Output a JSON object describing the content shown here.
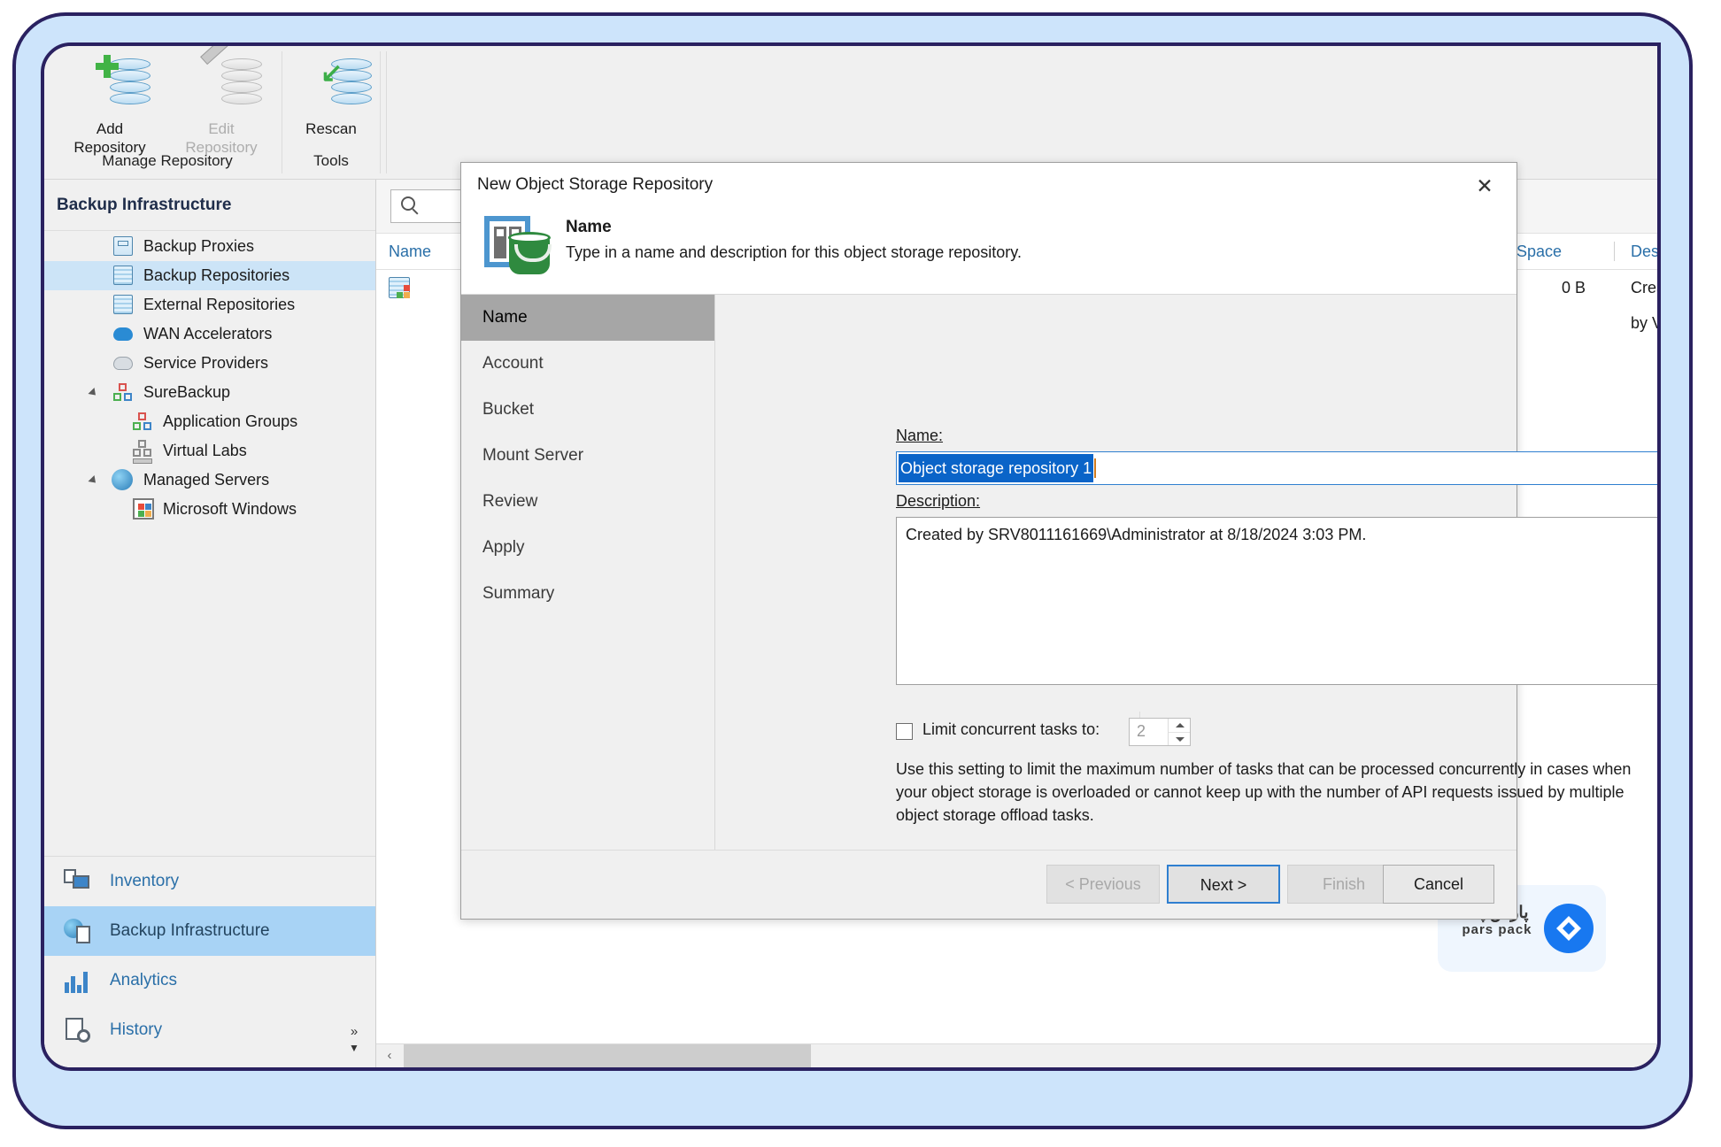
{
  "ribbon": {
    "groups": [
      {
        "label": "Manage Repository"
      },
      {
        "label": "Tools"
      }
    ],
    "buttons": [
      {
        "label_line1": "Add",
        "label_line2": "Repository",
        "icon": "database-add-icon",
        "enabled": true
      },
      {
        "label_line1": "Edit",
        "label_line2": "Repository",
        "icon": "database-edit-icon",
        "enabled": false
      },
      {
        "label_line1": "Rescan",
        "label_line2": "",
        "icon": "database-rescan-icon",
        "enabled": true
      }
    ]
  },
  "sidebar": {
    "title": "Backup Infrastructure",
    "items": [
      {
        "label": "Backup Proxies",
        "icon": "server-icon",
        "indent": 0,
        "selected": false,
        "expander": false
      },
      {
        "label": "Backup Repositories",
        "icon": "repository-icon",
        "indent": 0,
        "selected": true,
        "expander": false
      },
      {
        "label": "External Repositories",
        "icon": "cloud-repo-icon",
        "indent": 0,
        "selected": false,
        "expander": false
      },
      {
        "label": "WAN Accelerators",
        "icon": "cloud-arrow-icon",
        "indent": 0,
        "selected": false,
        "expander": false
      },
      {
        "label": "Service Providers",
        "icon": "cloud-gray-icon",
        "indent": 0,
        "selected": false,
        "expander": false
      },
      {
        "label": "SureBackup",
        "icon": "blocks-icon",
        "indent": 0,
        "selected": false,
        "expander": true
      },
      {
        "label": "Application Groups",
        "icon": "blocks-icon",
        "indent": 1,
        "selected": false,
        "expander": false
      },
      {
        "label": "Virtual Labs",
        "icon": "virtual-lab-icon",
        "indent": 1,
        "selected": false,
        "expander": false
      },
      {
        "label": "Managed Servers",
        "icon": "globe-server-icon",
        "indent": 0,
        "selected": false,
        "expander": true
      },
      {
        "label": "Microsoft Windows",
        "icon": "windows-icon",
        "indent": 1,
        "selected": false,
        "expander": false
      }
    ]
  },
  "bottom_nav": {
    "items": [
      {
        "label": "Inventory",
        "icon": "inventory-icon",
        "selected": false
      },
      {
        "label": "Backup Infrastructure",
        "icon": "globe-server-icon",
        "selected": true
      },
      {
        "label": "Analytics",
        "icon": "chart-icon",
        "selected": false
      },
      {
        "label": "History",
        "icon": "history-icon",
        "selected": false
      }
    ],
    "expand_glyph": "»",
    "more_glyph": "▼"
  },
  "content": {
    "search_placeholder": "",
    "search_value": "",
    "columns": [
      {
        "label": "Name"
      },
      {
        "label": "Space"
      },
      {
        "label": "Description"
      }
    ],
    "row": {
      "name": "",
      "space": "0 B",
      "description": "Created by Vee"
    },
    "scroll_left_glyph": "‹"
  },
  "dialog": {
    "title": "New Object Storage Repository",
    "close_glyph": "✕",
    "header_icon": "object-storage-icon",
    "header_title": "Name",
    "header_subtitle": "Type in a name and description for this object storage repository.",
    "steps": [
      {
        "label": "Name",
        "active": true
      },
      {
        "label": "Account",
        "active": false
      },
      {
        "label": "Bucket",
        "active": false
      },
      {
        "label": "Mount Server",
        "active": false
      },
      {
        "label": "Review",
        "active": false
      },
      {
        "label": "Apply",
        "active": false
      },
      {
        "label": "Summary",
        "active": false
      }
    ],
    "name_label": "Name:",
    "name_value": "Object storage repository 1",
    "description_label": "Description:",
    "description_value": "Created by SRV8011161669\\Administrator at 8/18/2024 3:03 PM.",
    "limit_checkbox_label": "Limit concurrent tasks to:",
    "limit_checked": false,
    "limit_value": "2",
    "limit_help": "Use this setting to limit the maximum number of tasks that can be processed concurrently in cases when your object storage is overloaded or cannot keep up with the number of API requests issued by multiple object storage offload tasks.",
    "buttons": {
      "previous": "< Previous",
      "next": "Next >",
      "finish": "Finish",
      "cancel": "Cancel"
    }
  },
  "logo": {
    "fa": "پارس پک",
    "en": "pars pack"
  },
  "colors": {
    "frame_border": "#2a2160",
    "frame_fill": "#cde4fb",
    "selection_blue": "#cce4f7",
    "nav_selected": "#a8d3f5",
    "accent_link": "#2a6fa8",
    "text_select_bg": "#0a64c8",
    "default_button_border": "#2f7fd0",
    "step_active_bg": "#a6a6a6",
    "logo_blue": "#1878f0"
  }
}
